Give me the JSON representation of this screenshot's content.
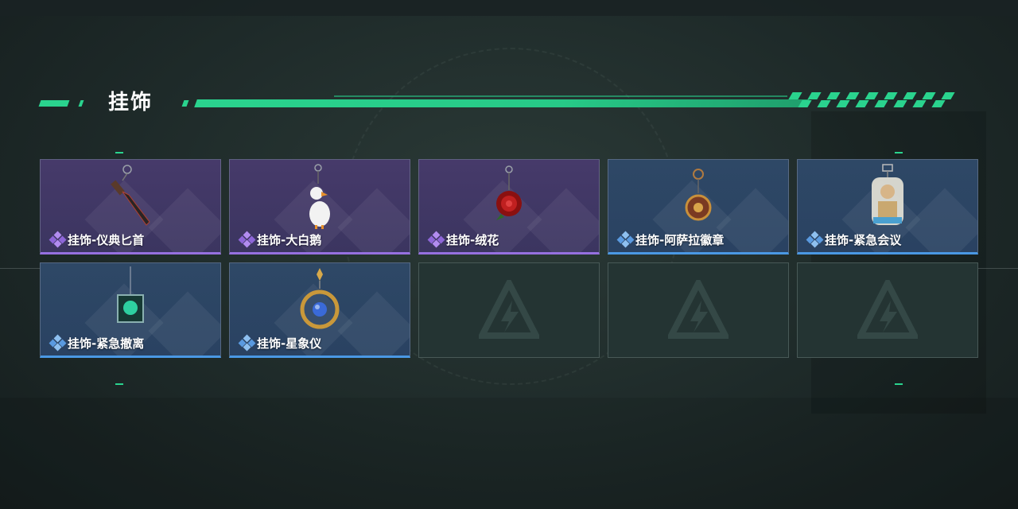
{
  "section": {
    "title": "挂饰"
  },
  "colors": {
    "accent": "#2ad38e",
    "rarity_purple": "#9670e0",
    "rarity_blue": "#4a98e4"
  },
  "items": [
    {
      "label": "挂饰-仪典匕首",
      "rarity": "purple",
      "icon": "dagger-charm-icon"
    },
    {
      "label": "挂饰-大白鹅",
      "rarity": "purple",
      "icon": "goose-charm-icon"
    },
    {
      "label": "挂饰-绒花",
      "rarity": "purple",
      "icon": "red-flower-charm-icon"
    },
    {
      "label": "挂饰-阿萨拉徽章",
      "rarity": "blue",
      "icon": "badge-charm-icon"
    },
    {
      "label": "挂饰-紧急会议",
      "rarity": "blue",
      "icon": "acrylic-figure-charm-icon"
    },
    {
      "label": "挂饰-紧急撤离",
      "rarity": "blue",
      "icon": "green-cube-charm-icon"
    },
    {
      "label": "挂饰-星象仪",
      "rarity": "blue",
      "icon": "astrolabe-charm-icon"
    },
    {
      "label": "",
      "rarity": "empty",
      "icon": "empty-slot-logo-icon"
    },
    {
      "label": "",
      "rarity": "empty",
      "icon": "empty-slot-logo-icon"
    },
    {
      "label": "",
      "rarity": "empty",
      "icon": "empty-slot-logo-icon"
    }
  ]
}
